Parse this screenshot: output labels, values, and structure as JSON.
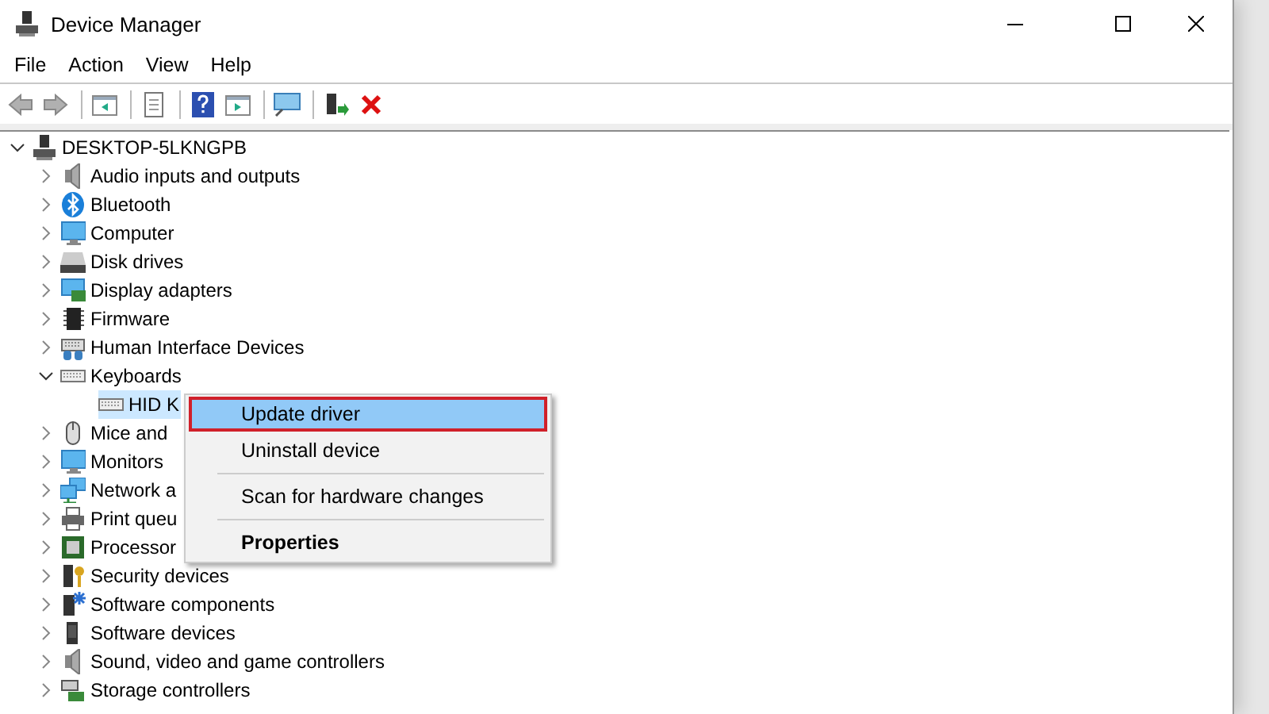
{
  "window": {
    "title": "Device Manager"
  },
  "menu_bar": [
    {
      "label": "File"
    },
    {
      "label": "Action"
    },
    {
      "label": "View"
    },
    {
      "label": "Help"
    }
  ],
  "tree": {
    "label": "DESKTOP-5LKNGPB",
    "expanded": true,
    "children": [
      {
        "label": "Audio inputs and outputs",
        "expanded": false
      },
      {
        "label": "Bluetooth",
        "expanded": false
      },
      {
        "label": "Computer",
        "expanded": false
      },
      {
        "label": "Disk drives",
        "expanded": false
      },
      {
        "label": "Display adapters",
        "expanded": false
      },
      {
        "label": "Firmware",
        "expanded": false
      },
      {
        "label": "Human Interface Devices",
        "expanded": false
      },
      {
        "label": "Keyboards",
        "expanded": true,
        "children": [
          {
            "label": "HID K",
            "selected": true
          }
        ]
      },
      {
        "label": "Mice and",
        "expanded": false
      },
      {
        "label": "Monitors",
        "expanded": false
      },
      {
        "label": "Network a",
        "expanded": false
      },
      {
        "label": "Print queu",
        "expanded": false
      },
      {
        "label": "Processor",
        "expanded": false
      },
      {
        "label": "Security devices",
        "expanded": false
      },
      {
        "label": "Software components",
        "expanded": false
      },
      {
        "label": "Software devices",
        "expanded": false
      },
      {
        "label": "Sound, video and game controllers",
        "expanded": false
      },
      {
        "label": "Storage controllers",
        "expanded": false
      }
    ]
  },
  "context_menu": [
    {
      "kind": "item",
      "label": "Update driver",
      "highlighted": true,
      "bold": false
    },
    {
      "kind": "item",
      "label": "Uninstall device",
      "highlighted": false,
      "bold": false
    },
    {
      "kind": "separator"
    },
    {
      "kind": "item",
      "label": "Scan for hardware changes",
      "highlighted": false,
      "bold": false
    },
    {
      "kind": "separator"
    },
    {
      "kind": "item",
      "label": "Properties",
      "highlighted": false,
      "bold": true
    }
  ]
}
